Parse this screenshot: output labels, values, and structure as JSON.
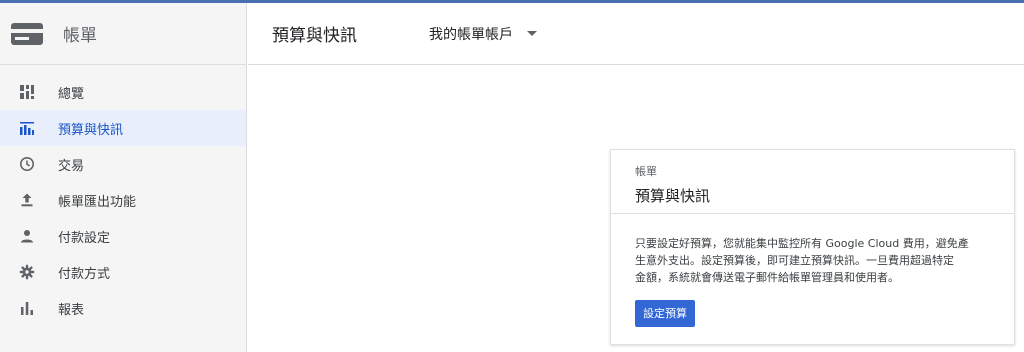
{
  "sidebar": {
    "title": "帳單",
    "icon": "credit-card-icon",
    "items": [
      {
        "label": "總覽",
        "icon": "dashboard-icon"
      },
      {
        "label": "預算與快訊",
        "icon": "budget-chart-icon",
        "active": true
      },
      {
        "label": "交易",
        "icon": "clock-icon"
      },
      {
        "label": "帳單匯出功能",
        "icon": "upload-icon"
      },
      {
        "label": "付款設定",
        "icon": "person-icon"
      },
      {
        "label": "付款方式",
        "icon": "gear-icon"
      },
      {
        "label": "報表",
        "icon": "bar-chart-icon"
      }
    ]
  },
  "header": {
    "title": "預算與快訊",
    "account": "我的帳單帳戶"
  },
  "card": {
    "subtitle": "帳單",
    "title": "預算與快訊",
    "body_lines": [
      "只要設定好預算，您就能集中監控所有 Google Cloud 費用，避免產",
      "生意外支出。設定預算後，即可建立預算快訊。一旦費用超過特定",
      "金額，系統就會傳送電子郵件給帳單管理員和使用者。"
    ],
    "button": "設定預算"
  },
  "colors": {
    "accent": "#1a56c9",
    "button": "#3367d6",
    "active_bg": "#e8eefb",
    "top_line": "#4a6fb5"
  }
}
